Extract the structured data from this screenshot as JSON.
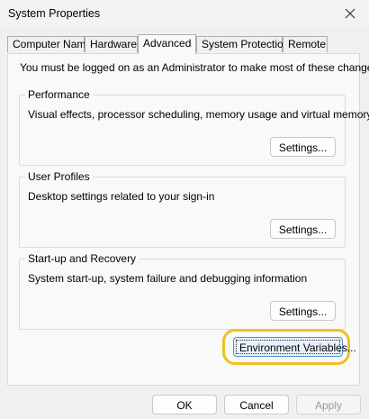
{
  "window": {
    "title": "System Properties"
  },
  "tabs": [
    {
      "label": "Computer Name",
      "active": false
    },
    {
      "label": "Hardware",
      "active": false
    },
    {
      "label": "Advanced",
      "active": true
    },
    {
      "label": "System Protection",
      "active": false
    },
    {
      "label": "Remote",
      "active": false
    }
  ],
  "advanced": {
    "admin_note": "You must be logged on as an Administrator to make most of these changes.",
    "performance": {
      "title": "Performance",
      "description": "Visual effects, processor scheduling, memory usage and virtual memory",
      "button": "Settings..."
    },
    "user_profiles": {
      "title": "User Profiles",
      "description": "Desktop settings related to your sign-in",
      "button": "Settings..."
    },
    "startup_recovery": {
      "title": "Start-up and Recovery",
      "description": "System start-up, system failure and debugging information",
      "button": "Settings..."
    },
    "env_button": "Environment Variables..."
  },
  "footer": {
    "ok": "OK",
    "cancel": "Cancel",
    "apply": "Apply"
  },
  "colors": {
    "highlight_ring": "#f0c020",
    "focused_button_border": "#5a8cc8"
  },
  "icons": {
    "close": "close-icon"
  }
}
